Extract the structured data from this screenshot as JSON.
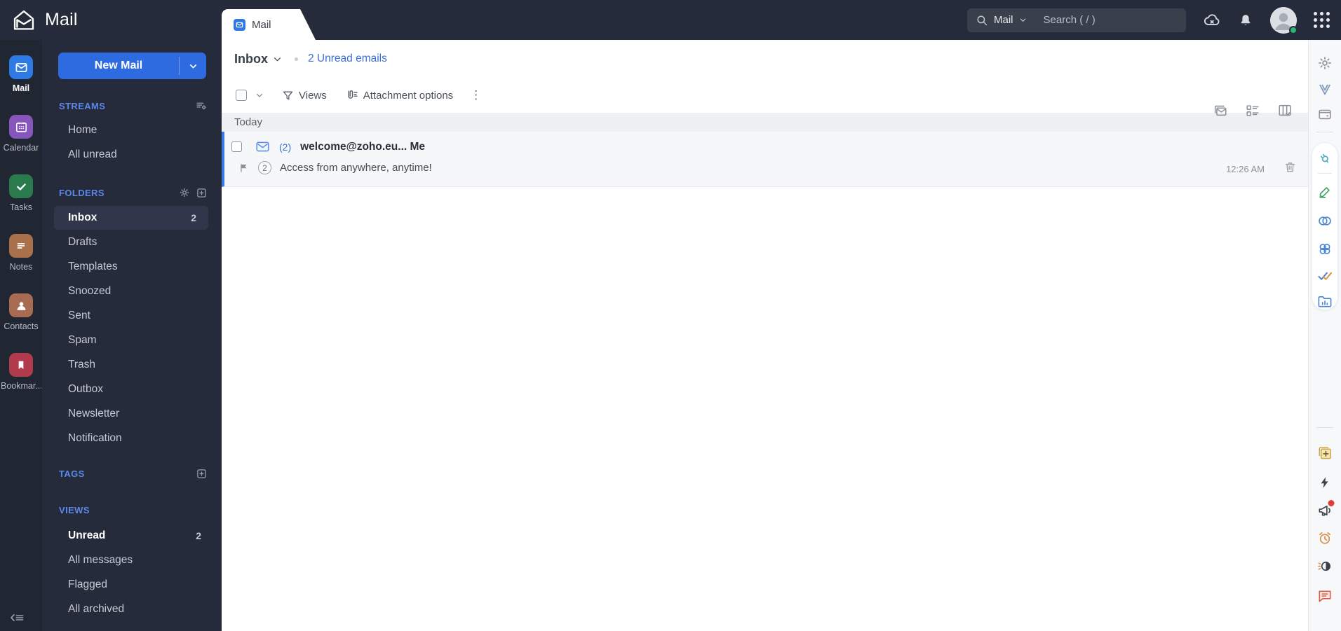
{
  "colors": {
    "topbar_bg": "#252b3a",
    "rail_bg": "#212633",
    "accent_blue": "#2e6be0",
    "section_header_blue": "#5c87ea",
    "link_blue": "#3a6fd8",
    "unread_bar_blue": "#3b79e2",
    "status_green": "#2bb673"
  },
  "topbar": {
    "product": "Mail",
    "search_scope": "Mail",
    "search_placeholder": "Search ( / )",
    "icons": [
      "search-icon",
      "cloud-sync-icon",
      "notifications-bell-icon",
      "user-avatar",
      "apps-grid-icon"
    ]
  },
  "tab": {
    "label": "Mail"
  },
  "app_rail": {
    "items": [
      {
        "label": "Mail",
        "active": true,
        "color": "#2e7ae5"
      },
      {
        "label": "Calendar",
        "active": false,
        "color": "#8656bd"
      },
      {
        "label": "Tasks",
        "active": false,
        "color": "#297a4c"
      },
      {
        "label": "Notes",
        "active": false,
        "color": "#a9714b"
      },
      {
        "label": "Contacts",
        "active": false,
        "color": "#a86a50"
      },
      {
        "label": "Bookmar...",
        "active": false,
        "color": "#b13a4c"
      }
    ]
  },
  "sidebar": {
    "new_mail": "New Mail",
    "streams": {
      "title": "STREAMS",
      "items": [
        {
          "label": "Home"
        },
        {
          "label": "All unread"
        }
      ]
    },
    "folders": {
      "title": "FOLDERS",
      "items": [
        {
          "label": "Inbox",
          "count": "2",
          "selected": true
        },
        {
          "label": "Drafts"
        },
        {
          "label": "Templates"
        },
        {
          "label": "Snoozed"
        },
        {
          "label": "Sent"
        },
        {
          "label": "Spam"
        },
        {
          "label": "Trash"
        },
        {
          "label": "Outbox"
        },
        {
          "label": "Newsletter"
        },
        {
          "label": "Notification"
        }
      ]
    },
    "tags": {
      "title": "TAGS"
    },
    "views": {
      "title": "VIEWS",
      "items": [
        {
          "label": "Unread",
          "count": "2",
          "bold": true
        },
        {
          "label": "All messages"
        },
        {
          "label": "Flagged"
        },
        {
          "label": "All archived"
        }
      ]
    }
  },
  "list_header": {
    "folder": "Inbox",
    "unread_link": "2 Unread emails",
    "right_icons": [
      "conversation-view-icon",
      "list-density-icon",
      "columns-view-icon"
    ]
  },
  "toolbar": {
    "views": "Views",
    "attachment_options": "Attachment options"
  },
  "mail_list": {
    "group": "Today",
    "emails": [
      {
        "thread_count": "(2)",
        "sender": "welcome@zoho.eu... Me",
        "badge": "2",
        "subject": "Access from anywhere, anytime!",
        "time": "12:26 AM"
      }
    ]
  },
  "right_rail": {
    "icons": [
      "settings-gear-icon",
      "zia-clip-icon",
      "wallet-icon",
      "plug-integrations-icon",
      "sign-icon",
      "crm-circles-icon",
      "knot-icon",
      "tasks-double-check-icon",
      "workdrive-folder-icon",
      "sticky-note-add-icon",
      "quick-actions-bolt-icon",
      "announcements-megaphone-icon",
      "reminders-clock-icon",
      "night-mode-icon",
      "feedback-chat-icon"
    ]
  }
}
